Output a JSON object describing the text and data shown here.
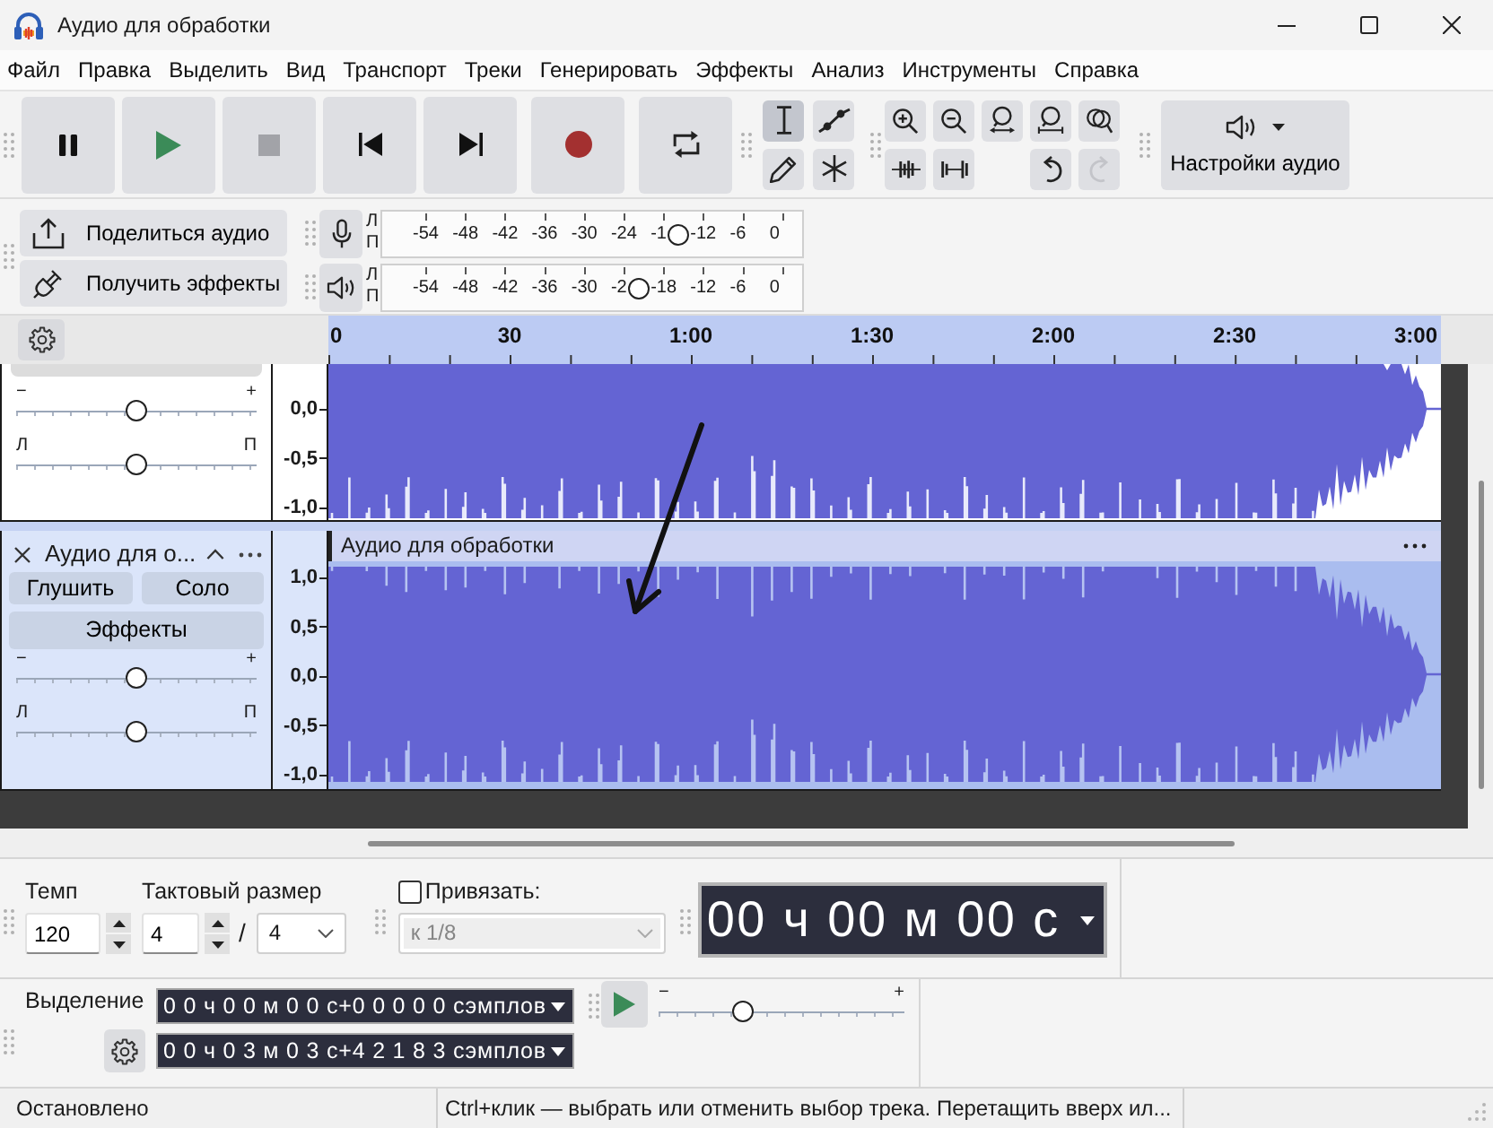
{
  "window": {
    "title": "Аудио для обработки"
  },
  "menu": [
    "Файл",
    "Правка",
    "Выделить",
    "Вид",
    "Транспорт",
    "Треки",
    "Генерировать",
    "Эффекты",
    "Анализ",
    "Инструменты",
    "Справка"
  ],
  "transport": [
    {
      "kind": "pause",
      "disabled": false
    },
    {
      "kind": "play",
      "disabled": false
    },
    {
      "kind": "stop",
      "disabled": true
    },
    {
      "kind": "skip-start",
      "disabled": false
    },
    {
      "kind": "skip-end",
      "disabled": false
    },
    {
      "kind": "record",
      "disabled": false
    },
    {
      "kind": "loop",
      "disabled": false
    }
  ],
  "tools": [
    {
      "kind": "select",
      "selected": true
    },
    {
      "kind": "envelope",
      "selected": false
    },
    {
      "kind": "draw",
      "selected": false
    },
    {
      "kind": "multi",
      "selected": false
    }
  ],
  "edit_tools": [
    {
      "kind": "zoom-in",
      "disabled": false
    },
    {
      "kind": "zoom-out",
      "disabled": false
    },
    {
      "kind": "fit-selection",
      "disabled": false
    },
    {
      "kind": "fit-project",
      "disabled": false
    },
    {
      "kind": "zoom-toggle",
      "disabled": false
    },
    {
      "kind": "trim",
      "disabled": false
    },
    {
      "kind": "silence",
      "disabled": false
    },
    {
      "kind": "undo",
      "disabled": false
    },
    {
      "kind": "redo",
      "disabled": true
    }
  ],
  "audio_setup": {
    "label": "Настройки аудио"
  },
  "share_audio": {
    "label": "Поделиться аудио"
  },
  "get_effects": {
    "label": "Получить эффекты"
  },
  "meters": [
    {
      "kind": "record",
      "channels": [
        "Л",
        "П"
      ],
      "ticks": [
        "-54",
        "-48",
        "-42",
        "-36",
        "-30",
        "-24",
        "-1",
        "-12",
        "-6",
        "0"
      ],
      "level": 0.705
    },
    {
      "kind": "playback",
      "channels": [
        "Л",
        "П"
      ],
      "ticks": [
        "-54",
        "-48",
        "-42",
        "-36",
        "-30",
        "-2",
        "-18",
        "-12",
        "-6",
        "0"
      ],
      "level": 0.61
    }
  ],
  "ruler": {
    "labels": [
      "0",
      "30",
      "1:00",
      "1:30",
      "2:00",
      "2:30",
      "3:00"
    ]
  },
  "tracks": [
    {
      "selected": false,
      "gain": {
        "minus": "−",
        "plus": "+",
        "level": 0.5
      },
      "pan": {
        "left": "Л",
        "right": "П",
        "level": 0.5
      },
      "scale": [
        "0,0",
        "-0,5",
        "-1,0"
      ]
    },
    {
      "selected": true,
      "title": "Аудио для о...",
      "mute": "Глушить",
      "solo": "Соло",
      "effects": "Эффекты",
      "gain": {
        "minus": "−",
        "plus": "+",
        "level": 0.5
      },
      "pan": {
        "left": "Л",
        "right": "П",
        "level": 0.5
      },
      "scale": [
        "1,0",
        "0,5",
        "0,0",
        "-0,5",
        "-1,0"
      ],
      "clip_title": "Аудио для обработки"
    }
  ],
  "bottom_toolbar": {
    "tempo": {
      "label": "Темп",
      "value": "120"
    },
    "time_signature": {
      "label": "Тактовый размер",
      "upper": "4",
      "separator": "/",
      "lower": "4"
    },
    "snap": {
      "label": "Привязать:",
      "checked": false,
      "value": "к 1/8",
      "disabled": true
    },
    "time": "00 ч 00 м 00 с"
  },
  "selection_toolbar": {
    "label": "Выделение",
    "start": "0 0 ч 0 0 м 0 0 с+0 0 0 0 0 сэмплов",
    "end": "0 0 ч 0 3 м 0 3 с+4 2 1 8 3 сэмплов"
  },
  "play_at_speed": {
    "minus": "−",
    "plus": "+",
    "level": 0.34
  },
  "status_bar": [
    "Остановлено",
    "Ctrl+клик — выбрать или отменить выбор трека. Перетащить вверх ил..."
  ]
}
